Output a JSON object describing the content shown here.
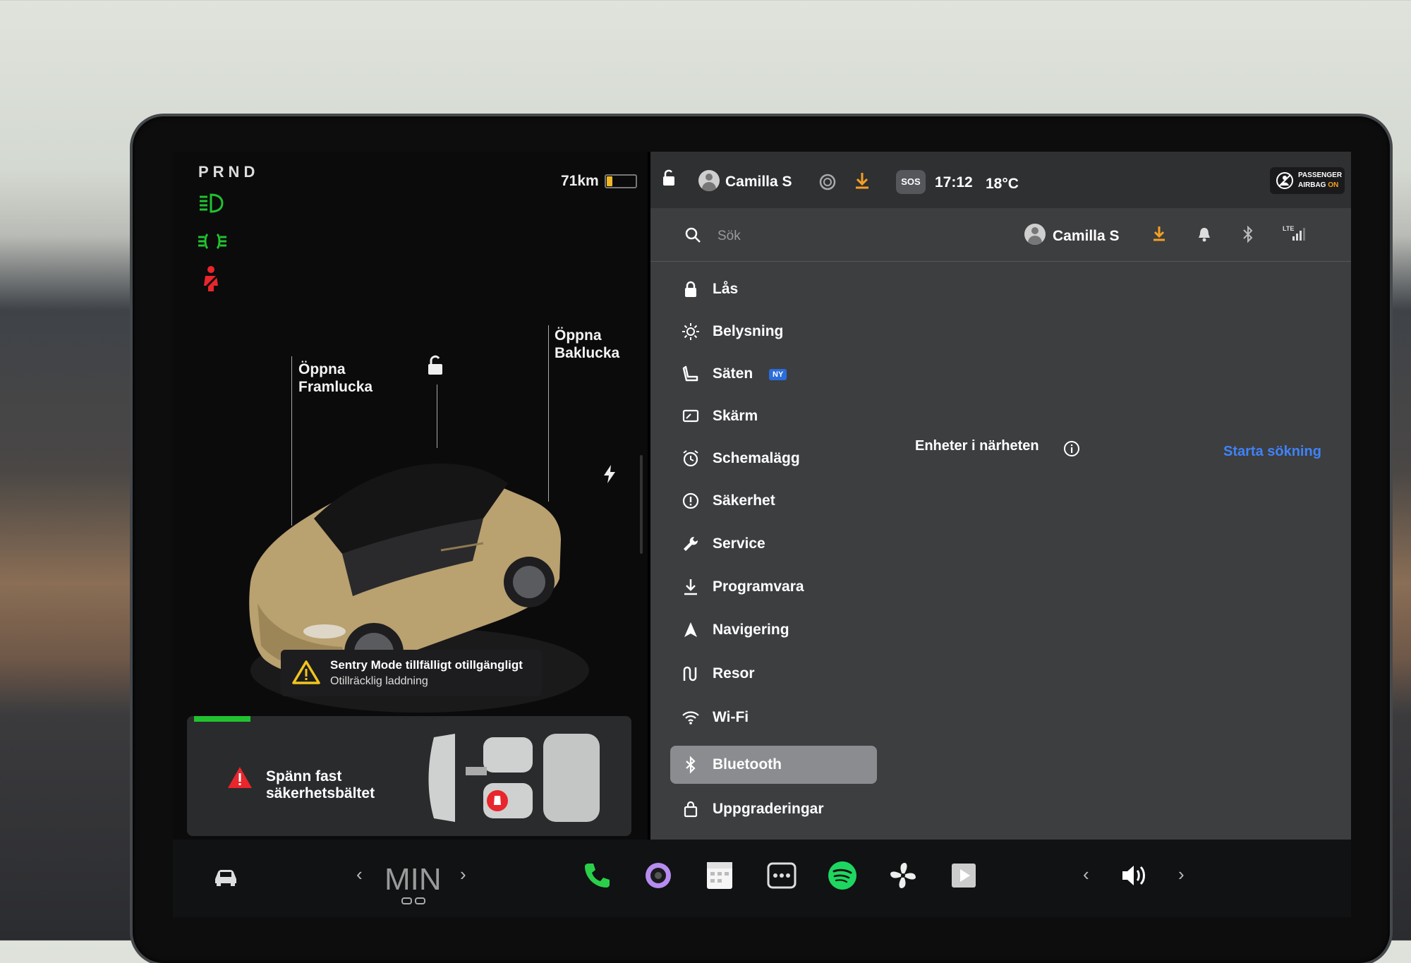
{
  "left_panel": {
    "gear": "PRND",
    "range": "71km",
    "battery_level_pct": 20,
    "callouts": {
      "frunk": "Öppna\nFramlucka",
      "trunk": "Öppna\nBaklucka"
    },
    "sentry_alert": {
      "title": "Sentry Mode tillfälligt otillgängligt",
      "subtitle": "Otillräcklig laddning"
    },
    "seatbelt_alert": "Spänn fast\nsäkerhetsbältet",
    "colors": {
      "green": "#21c22f",
      "red": "#e8262b",
      "warn_yellow": "#f2c51d"
    }
  },
  "status_bar": {
    "profile_name": "Camilla S",
    "sos": "SOS",
    "time": "17:12",
    "temperature": "18°C",
    "airbag_line1": "PASSENGER",
    "airbag_line2": "AIRBAG",
    "airbag_state": "ON"
  },
  "search": {
    "placeholder": "Sök",
    "profile_name": "Camilla S",
    "lte": "LTE"
  },
  "menu": [
    {
      "label": "Lås",
      "icon": "lock-icon"
    },
    {
      "label": "Belysning",
      "icon": "sun-icon"
    },
    {
      "label": "Säten",
      "icon": "seat-icon",
      "badge": "NY"
    },
    {
      "label": "Skärm",
      "icon": "display-icon"
    },
    {
      "label": "Schemalägg",
      "icon": "alarm-clock-icon"
    },
    {
      "label": "Säkerhet",
      "icon": "alert-circle-icon"
    },
    {
      "label": "Service",
      "icon": "wrench-icon"
    },
    {
      "label": "Programvara",
      "icon": "download-icon"
    },
    {
      "label": "Navigering",
      "icon": "navigation-arrow-icon"
    },
    {
      "label": "Resor",
      "icon": "trips-icon"
    },
    {
      "label": "Wi-Fi",
      "icon": "wifi-icon"
    },
    {
      "label": "Bluetooth",
      "icon": "bluetooth-icon",
      "active": true
    },
    {
      "label": "Uppgraderingar",
      "icon": "bag-icon"
    }
  ],
  "bluetooth_panel": {
    "nearby_title": "Enheter i närheten",
    "start_search": "Starta sökning"
  },
  "dock": {
    "fan_mode": "MIN",
    "apps": [
      "car-icon",
      "phone-icon",
      "camera-icon",
      "calendar-icon",
      "more-apps-icon",
      "spotify-icon",
      "fan-icon",
      "media-player-icon",
      "volume-icon"
    ]
  }
}
